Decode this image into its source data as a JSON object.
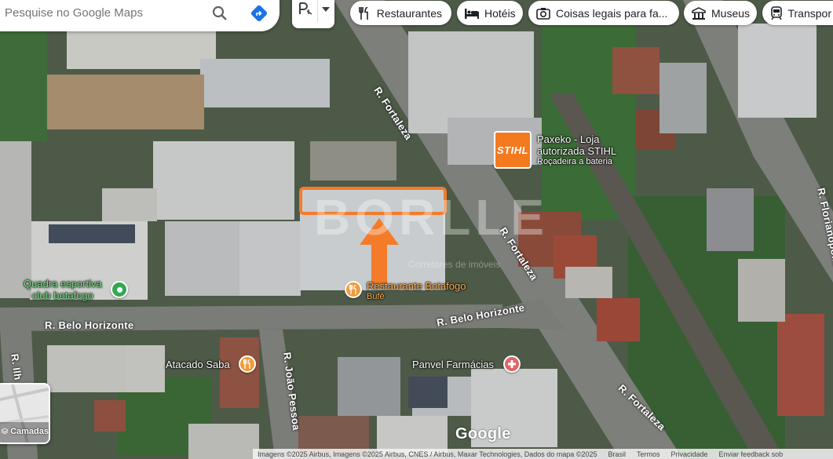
{
  "search": {
    "placeholder": "Pesquise no Google Maps"
  },
  "chips": [
    {
      "label": "Restaurantes",
      "icon": "fork-knife-icon"
    },
    {
      "label": "Hotéis",
      "icon": "bed-icon"
    },
    {
      "label": "Coisas legais para fa...",
      "icon": "camera-icon"
    },
    {
      "label": "Museus",
      "icon": "museum-icon"
    },
    {
      "label": "Transpor",
      "icon": "transit-icon"
    }
  ],
  "streets": {
    "fortaleza_top": "R. Fortaleza",
    "fortaleza_mid": "R. Fortaleza",
    "fortaleza_bottom": "R. Fortaleza",
    "belo_horizonte_left": "R. Belo Horizonte",
    "belo_horizonte_right": "R. Belo Horizonte",
    "joao_pessoa": "R. João Pessoa",
    "florianopolis": "R. Florianópolis",
    "ilheus": "R. Ilh"
  },
  "places": {
    "stihl": {
      "name_line1": "Paxeko - Loja",
      "name_line2": "autorizada STIHL",
      "subtitle": "Roçadeira a bateria",
      "logo_text": "STIHL"
    },
    "quadra": {
      "line1": "Quadra esportiva",
      "line2": "club botafogo"
    },
    "restaurante": {
      "name": "Restaurante Botafogo",
      "subtitle": "Bufê"
    },
    "atacado": {
      "name": "Atacado Saba"
    },
    "panvel": {
      "name": "Panvel Farmácias"
    }
  },
  "watermark": {
    "text": "BORLLE",
    "sub": "Corretores de imóveis"
  },
  "layers": {
    "label": "Camadas"
  },
  "google_logo": "Google",
  "footer": {
    "attribution": "Imagens ©2025 Airbus, Imagens ©2025 Airbus, CNES / Airbus, Maxar Technologies, Dados do mapa ©2025",
    "country": "Brasil",
    "terms": "Termos",
    "privacy": "Privacidade",
    "feedback": "Enviar feedback sob"
  },
  "colors": {
    "accent": "#f47b2a",
    "stihl": "#f37a1f",
    "poi_green": "#34a853",
    "poi_orange": "#f29b38",
    "poi_red": "#e06666",
    "directions_blue": "#1a73e8"
  }
}
